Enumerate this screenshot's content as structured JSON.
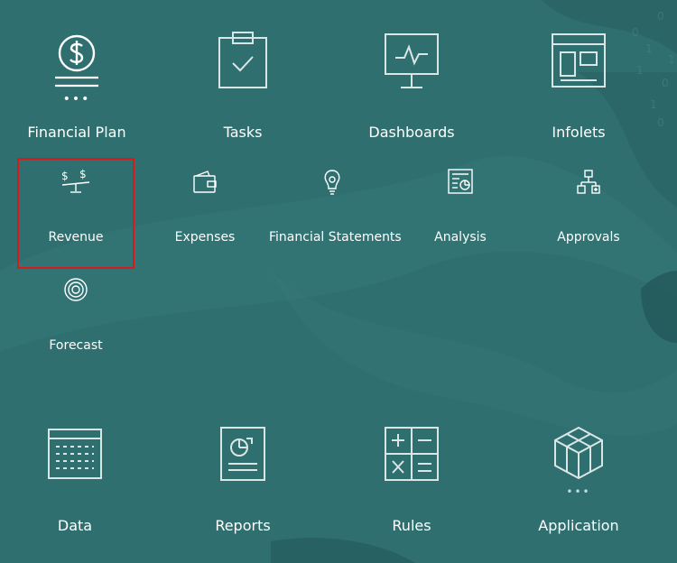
{
  "top_row": [
    {
      "label": "Financial Plan",
      "icon": "dollar-circle-icon",
      "more": "•••"
    },
    {
      "label": "Tasks",
      "icon": "clipboard-check-icon"
    },
    {
      "label": "Dashboards",
      "icon": "monitor-pulse-icon"
    },
    {
      "label": "Infolets",
      "icon": "window-panels-icon"
    }
  ],
  "sub_row": [
    {
      "label": "Revenue",
      "icon": "scale-dollar-icon"
    },
    {
      "label": "Expenses",
      "icon": "wallet-icon"
    },
    {
      "label": "Financial Statements",
      "icon": "lightbulb-icon"
    },
    {
      "label": "Analysis",
      "icon": "report-chart-icon"
    },
    {
      "label": "Approvals",
      "icon": "hierarchy-icon"
    },
    {
      "label": "Forecast",
      "icon": "target-icon"
    }
  ],
  "bottom_row": [
    {
      "label": "Data",
      "icon": "list-grid-icon"
    },
    {
      "label": "Reports",
      "icon": "document-pie-icon"
    },
    {
      "label": "Rules",
      "icon": "calculator-icon"
    },
    {
      "label": "Application",
      "icon": "cube-icon",
      "more": "•••"
    }
  ],
  "colors": {
    "background": "#2f6f70",
    "selection_border": "#d31d1d",
    "icon_stroke": "#d9e6e6"
  }
}
